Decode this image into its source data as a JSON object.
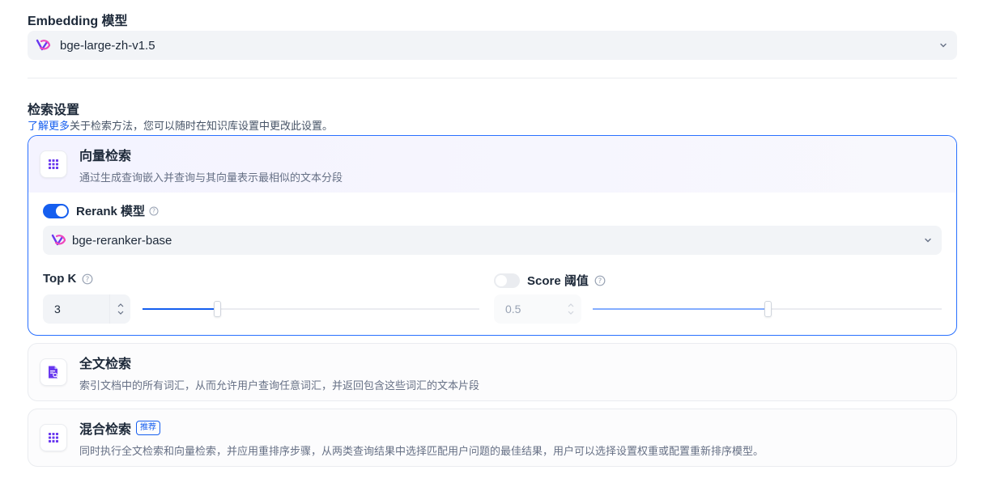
{
  "embedding": {
    "title": "Embedding 模型",
    "model": "bge-large-zh-v1.5"
  },
  "retrieval": {
    "title": "检索设置",
    "learn_more": "了解更多",
    "description": "关于检索方法，您可以随时在知识库设置中更改此设置。"
  },
  "vector": {
    "title": "向量检索",
    "description": "通过生成查询嵌入并查询与其向量表示最相似的文本分段",
    "rerank_label": "Rerank 模型",
    "rerank_enabled": true,
    "rerank_model": "bge-reranker-base",
    "topk_label": "Top K",
    "topk_value": "3",
    "topk_fraction": 0.22,
    "score_label": "Score 阈值",
    "score_enabled": false,
    "score_value": "0.5",
    "score_fraction": 0.5
  },
  "fulltext": {
    "title": "全文检索",
    "description": "索引文档中的所有词汇，从而允许用户查询任意词汇，并返回包含这些词汇的文本片段"
  },
  "hybrid": {
    "title": "混合检索",
    "badge": "推荐",
    "description": "同时执行全文检索和向量检索，并应用重排序步骤，从两类查询结果中选择匹配用户问题的最佳结果，用户可以选择设置权重或配置重新排序模型。"
  },
  "colors": {
    "accent": "#155eef",
    "icon_purple": "#6938ef"
  }
}
